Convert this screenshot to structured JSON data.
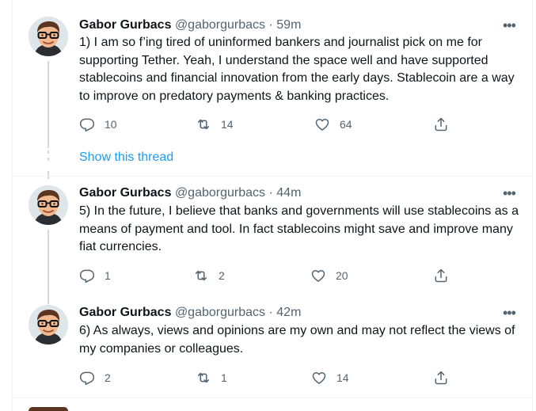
{
  "tweets": [
    {
      "name": "Gabor Gurbacs",
      "handle": "@gaborgurbacs",
      "time": "59m",
      "text": "1) I am so f’ing tired of uninformed bankers and journalist pick on me for supporting Tether. Yeah, I understand the space well and have supported stablecoins and financial innovation from the early days. Stablecoin are a way to improve on predatory payments & banking practices.",
      "replies": "10",
      "retweets": "14",
      "likes": "64"
    },
    {
      "name": "Gabor Gurbacs",
      "handle": "@gaborgurbacs",
      "time": "44m",
      "text": "5) In the future, I believe that banks and governments will use stablecoins as a means of payment and tool. In fact stablecoins might save and improve many fiat currencies.",
      "replies": "1",
      "retweets": "2",
      "likes": "20"
    },
    {
      "name": "Gabor Gurbacs",
      "handle": "@gaborgurbacs",
      "time": "42m",
      "text": "6) As always, views and opinions are my own and may not reflect the views of my companies or colleagues.",
      "replies": "2",
      "retweets": "1",
      "likes": "14"
    }
  ],
  "separator": "·",
  "more_glyph": "•••",
  "show_thread": "Show this thread",
  "colors": {
    "accent": "#1d9bf0",
    "muted": "#536471",
    "text": "#0f1419",
    "border": "#eff3f4"
  },
  "icons": [
    "reply-icon",
    "retweet-icon",
    "like-icon",
    "share-icon",
    "more-icon"
  ]
}
